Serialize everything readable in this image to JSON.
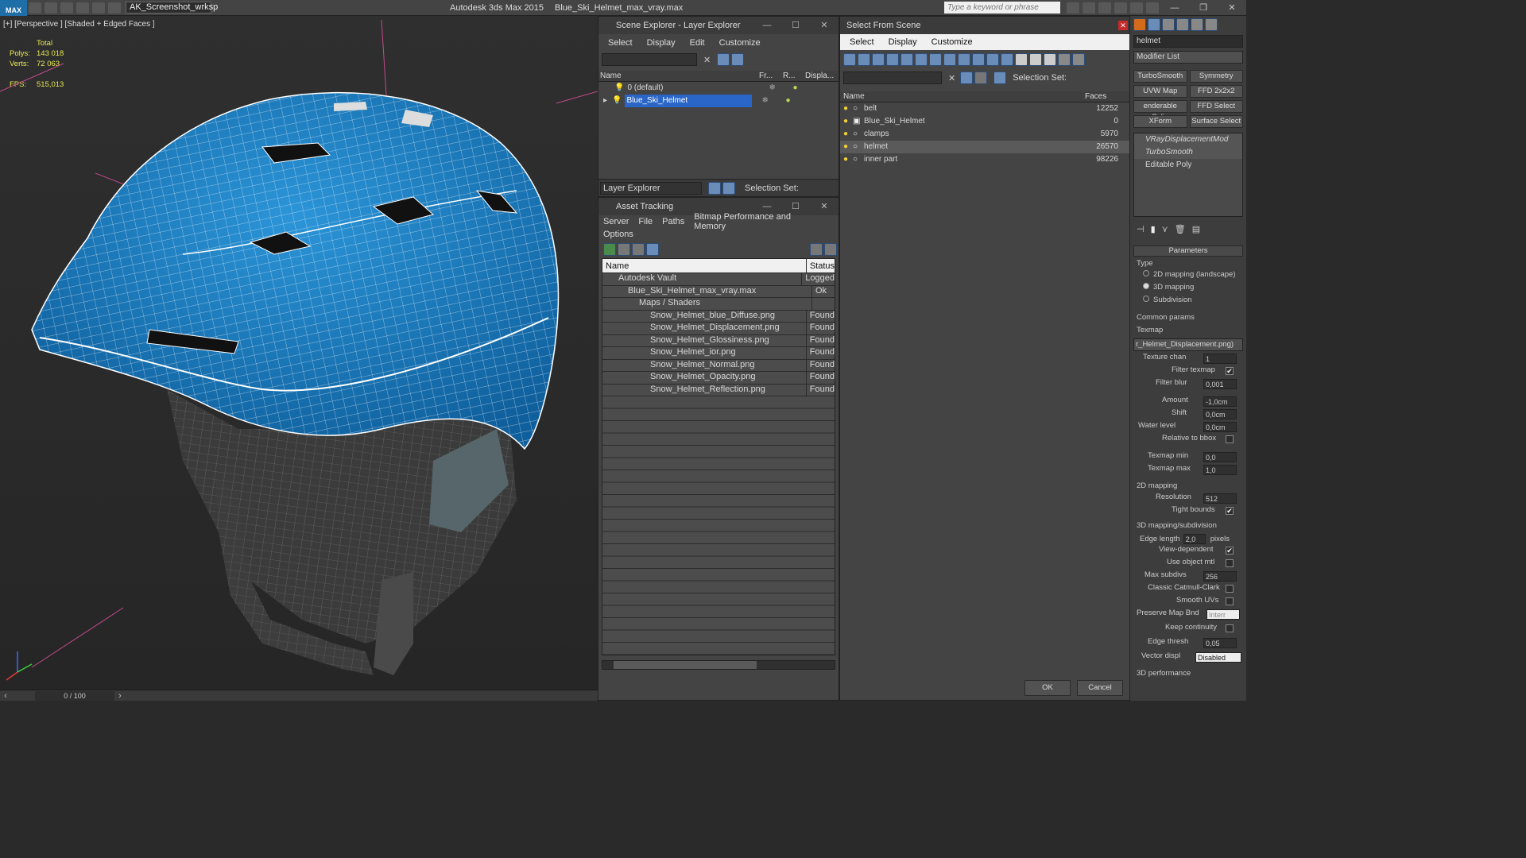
{
  "titlebar": {
    "app_title": "Autodesk 3ds Max  2015",
    "file_title": "Blue_Ski_Helmet_max_vray.max",
    "workspace": "AK_Screenshot_wrksp",
    "search_placeholder": "Type a keyword or phrase",
    "logo": "MAX"
  },
  "viewport": {
    "label": "[+] [Perspective ] [Shaded + Edged Faces ]",
    "stats_total_label": "Total",
    "polys_label": "Polys:",
    "polys_value": "143 018",
    "verts_label": "Verts:",
    "verts_value": "72 063",
    "fps_label": "FPS:",
    "fps_value": "515,013",
    "timeline": "0 / 100",
    "mesh_colors": {
      "helmet": "#1e7cc0",
      "inner": "#3b3b3b",
      "wire": "#ffffff"
    }
  },
  "layer_explorer": {
    "title": "Scene Explorer - Layer Explorer",
    "menu": [
      "Select",
      "Display",
      "Edit",
      "Customize"
    ],
    "columns": [
      "Name",
      "Fr...",
      "R...",
      "Displa..."
    ],
    "rows": [
      {
        "name": "0 (default)",
        "selected": false
      },
      {
        "name": "Blue_Ski_Helmet",
        "selected": true
      }
    ],
    "footer_label": "Layer Explorer",
    "selection_set_label": "Selection Set:"
  },
  "asset_tracking": {
    "title": "Asset Tracking",
    "menu": [
      "Server",
      "File",
      "Paths",
      "Bitmap Performance and Memory"
    ],
    "menu2": [
      "Options"
    ],
    "columns": [
      "Name",
      "Status"
    ],
    "rows": [
      {
        "name": "Autodesk Vault",
        "status": "Logged"
      },
      {
        "name": "Blue_Ski_Helmet_max_vray.max",
        "status": "Ok"
      },
      {
        "name": "Maps / Shaders",
        "status": ""
      },
      {
        "name": "Snow_Helmet_blue_Diffuse.png",
        "status": "Found"
      },
      {
        "name": "Snow_Helmet_Displacement.png",
        "status": "Found"
      },
      {
        "name": "Snow_Helmet_Glossiness.png",
        "status": "Found"
      },
      {
        "name": "Snow_Helmet_ior.png",
        "status": "Found"
      },
      {
        "name": "Snow_Helmet_Normal.png",
        "status": "Found"
      },
      {
        "name": "Snow_Helmet_Opacity.png",
        "status": "Found"
      },
      {
        "name": "Snow_Helmet_Reflection.png",
        "status": "Found"
      }
    ]
  },
  "select_from_scene": {
    "title": "Select From Scene",
    "menu": [
      "Select",
      "Display",
      "Customize"
    ],
    "selection_set_label": "Selection Set:",
    "columns": [
      "Name",
      "Faces"
    ],
    "rows": [
      {
        "name": "belt",
        "faces": "12252",
        "selected": false
      },
      {
        "name": "Blue_Ski_Helmet",
        "faces": "0",
        "selected": false
      },
      {
        "name": "clamps",
        "faces": "5970",
        "selected": false
      },
      {
        "name": "helmet",
        "faces": "26570",
        "selected": true
      },
      {
        "name": "inner part",
        "faces": "98226",
        "selected": false
      }
    ],
    "ok_label": "OK",
    "cancel_label": "Cancel"
  },
  "command_panel": {
    "object_name": "helmet",
    "modifier_list": "Modifier List",
    "buttons": [
      "TurboSmooth",
      "Symmetry",
      "UVW Map",
      "FFD 2x2x2",
      "enderable Splin",
      "FFD Select",
      "XForm",
      "Surface Select"
    ],
    "stack": [
      "VRayDisplacementMod",
      "TurboSmooth",
      "Editable Poly"
    ],
    "parameters_title": "Parameters",
    "type_label": "Type",
    "type_options": [
      "2D mapping (landscape)",
      "3D mapping",
      "Subdivision"
    ],
    "common_params": "Common params",
    "texmap_label": "Texmap",
    "texmap_value": "r_Helmet_Displacement.png)",
    "params": [
      {
        "label": "Texture chan",
        "value": "1"
      },
      {
        "label": "Filter texmap",
        "check": "✔"
      },
      {
        "label": "Filter blur",
        "value": "0,001"
      },
      {
        "label": "Amount",
        "value": "-1,0cm"
      },
      {
        "label": "Shift",
        "value": "0,0cm"
      },
      {
        "label": "Water level",
        "value": "0,0cm"
      },
      {
        "label": "Relative to bbox",
        "check": ""
      },
      {
        "label": "Texmap min",
        "value": "0,0"
      },
      {
        "label": "Texmap max",
        "value": "1,0"
      }
    ],
    "mapping2d_title": "2D mapping",
    "mapping2d": [
      {
        "label": "Resolution",
        "value": "512"
      },
      {
        "label": "Tight bounds",
        "check": "✔"
      }
    ],
    "mapping3d_title": "3D mapping/subdivision",
    "edge_length_label": "Edge length",
    "edge_length_value": "2,0",
    "pixels_label": "pixels",
    "mapping3d": [
      {
        "label": "View-dependent",
        "check": "✔"
      },
      {
        "label": "Use object mtl",
        "check": ""
      },
      {
        "label": "Max subdivs",
        "value": "256"
      },
      {
        "label": "Classic Catmull-Clark",
        "check": ""
      },
      {
        "label": "Smooth UVs",
        "check": ""
      },
      {
        "label": "Preserve Map Bnd",
        "value": "Interr"
      },
      {
        "label": "Keep continuity",
        "check": ""
      },
      {
        "label": "Edge thresh",
        "value": "0,05"
      },
      {
        "label": "Vector displ",
        "value": "Disabled"
      }
    ],
    "perf_title": "3D performance"
  }
}
